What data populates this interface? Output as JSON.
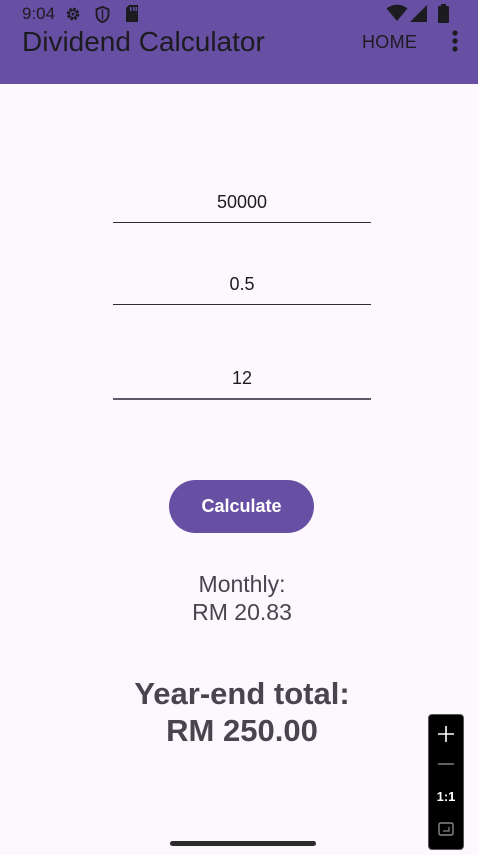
{
  "status_bar": {
    "time": "9:04",
    "icons": [
      "settings-gear-icon",
      "shield-icon",
      "sd-card-icon",
      "wifi-icon",
      "signal-icon",
      "battery-icon"
    ]
  },
  "app_bar": {
    "title": "Dividend Calculator",
    "home_label": "HOME",
    "more_icon": "more-vert-icon",
    "color": "#6750a4"
  },
  "form": {
    "investment_value": "50000",
    "rate_value": "0.5",
    "months_value": "12"
  },
  "actions": {
    "calculate_label": "Calculate",
    "color": "#6750a4"
  },
  "results": {
    "monthly_label": "Monthly:",
    "monthly_value": "RM 20.83",
    "yearend_label": "Year-end total:",
    "yearend_value": "RM 250.00"
  },
  "zoom_control": {
    "ratio_label": "1:1",
    "icons": [
      "zoom-in-icon",
      "zoom-out-icon",
      "fit-screen-icon"
    ]
  }
}
